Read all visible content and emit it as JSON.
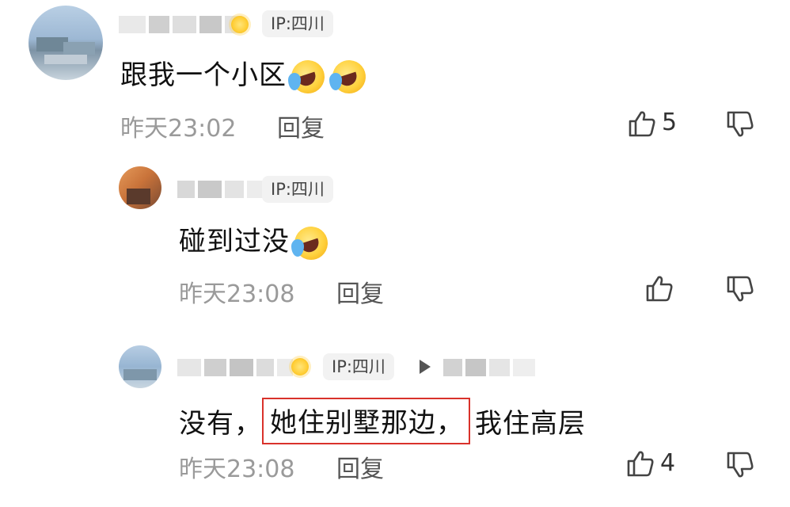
{
  "comments": [
    {
      "ip_badge": "IP:四川",
      "text": "跟我一个小区",
      "time": "昨天23:02",
      "reply_label": "回复",
      "like_count": "5"
    },
    {
      "ip_badge": "IP:四川",
      "text": "碰到过没",
      "time": "昨天23:08",
      "reply_label": "回复",
      "like_count": ""
    },
    {
      "ip_badge": "IP:四川",
      "text_before": "没有，",
      "text_highlight": "她住别墅那边，",
      "text_after": "我住高层",
      "time": "昨天23:08",
      "reply_label": "回复",
      "like_count": "4"
    }
  ],
  "icons": {
    "like": "thumbs-up-icon",
    "dislike": "thumbs-down-icon",
    "sun": "sun-badge-icon",
    "reply_arrow": "play-arrow-icon",
    "emoji": "laughing-crying-emoji"
  },
  "colors": {
    "highlight_border": "#d9322b",
    "badge_bg": "#f2f2f2",
    "meta_text": "#9a9a9a"
  }
}
